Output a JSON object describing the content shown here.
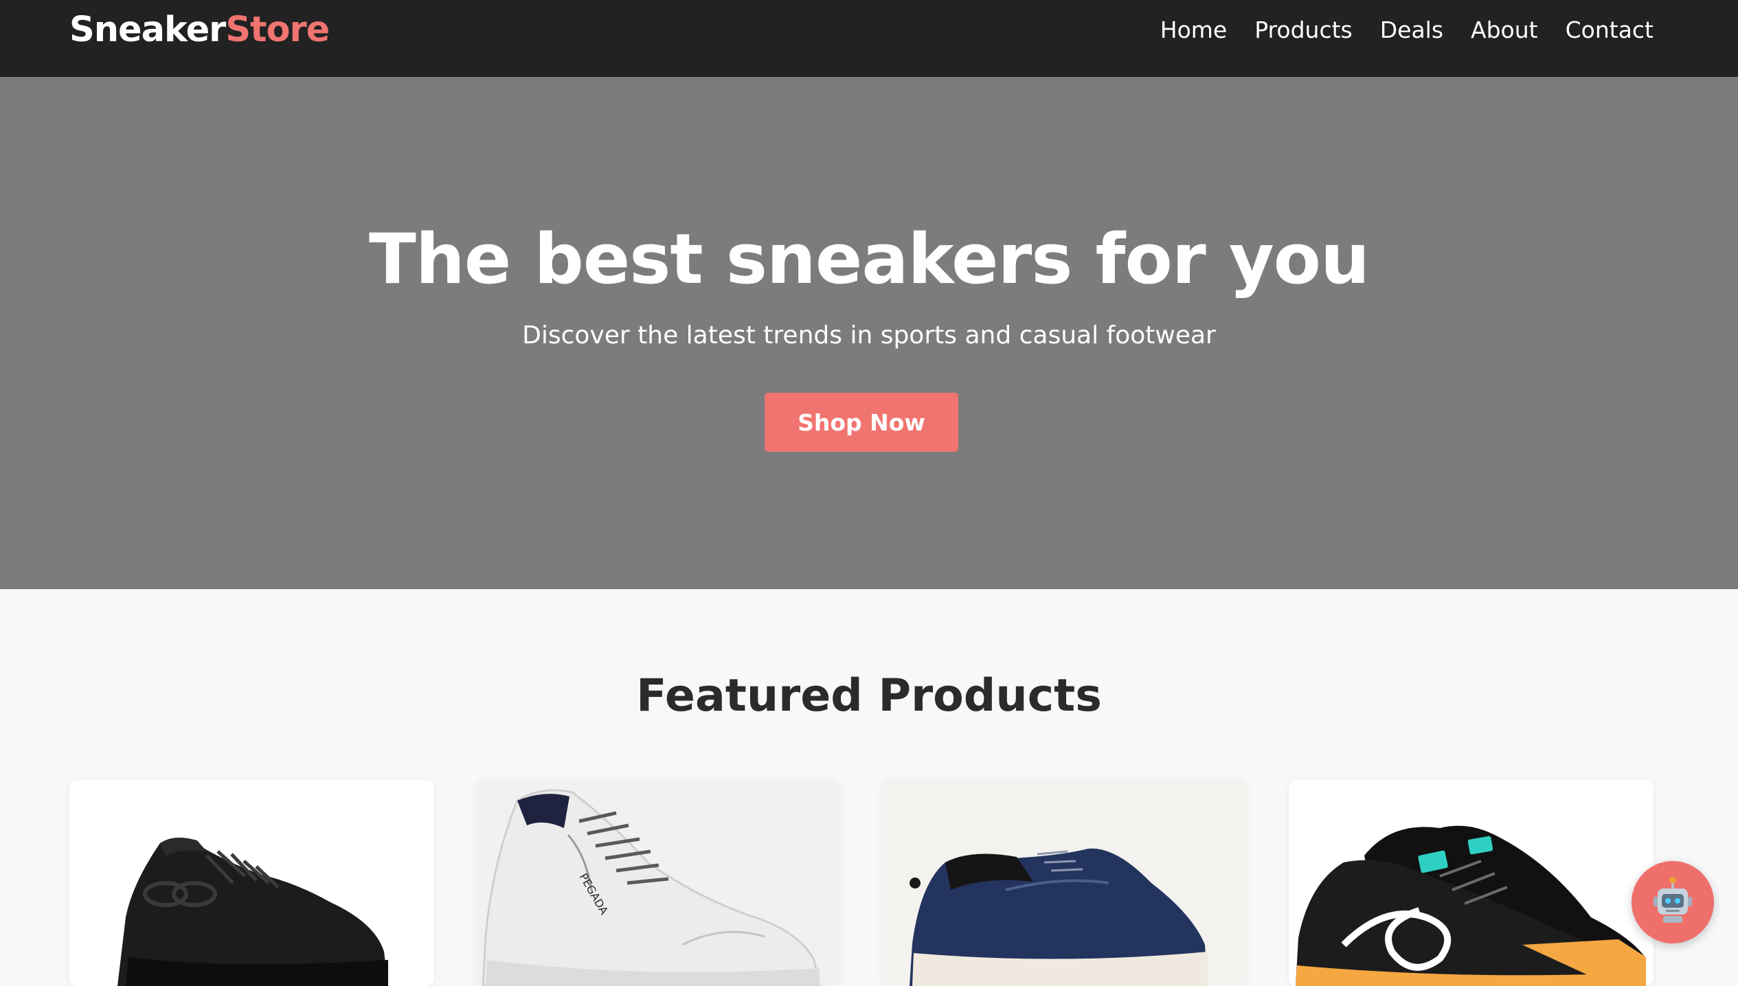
{
  "nav": {
    "brand_main": "Sneaker",
    "brand_accent": "Store",
    "links": [
      "Home",
      "Products",
      "Deals",
      "About",
      "Contact"
    ]
  },
  "hero": {
    "title": "The best sneakers for you",
    "subtitle": "Discover the latest trends in sports and casual footwear",
    "cta": "Shop Now"
  },
  "featured": {
    "title": "Featured Products",
    "products": [
      {
        "image": "black-knit-sneaker"
      },
      {
        "image": "white-leather-sneaker"
      },
      {
        "image": "navy-canvas-sneaker"
      },
      {
        "image": "black-suede-orange-sole-sneaker"
      }
    ]
  },
  "chat": {
    "icon": "robot-icon"
  },
  "colors": {
    "accent": "#f07470",
    "navbar": "#222222",
    "hero": "#7c7c7f",
    "page": "#f7f8fa"
  }
}
